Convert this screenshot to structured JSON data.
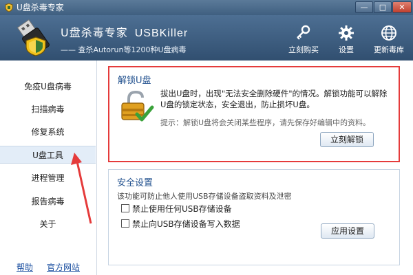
{
  "window": {
    "title": "U盘杀毒专家",
    "controls": {
      "minimize": "—",
      "maximize": "□",
      "close": "✕"
    }
  },
  "header": {
    "brand_cn": "U盘杀毒专家",
    "brand_en": "USBKiller",
    "slogan": "—— 查杀Autorun等1200种U盘病毒",
    "tools": [
      {
        "label": "立刻购买",
        "icon": "key-icon"
      },
      {
        "label": "设置",
        "icon": "gear-icon"
      },
      {
        "label": "更新毒库",
        "icon": "globe-icon"
      }
    ]
  },
  "sidebar": {
    "items": [
      {
        "label": "免疫U盘病毒"
      },
      {
        "label": "扫描病毒"
      },
      {
        "label": "修复系统"
      },
      {
        "label": "U盘工具",
        "active": true
      },
      {
        "label": "进程管理"
      },
      {
        "label": "报告病毒"
      },
      {
        "label": "关于"
      }
    ],
    "help_link": "帮助",
    "site_link": "官方网站"
  },
  "unlock_panel": {
    "title": "解锁U盘",
    "description": "拔出U盘时，出现\"无法安全删除硬件\"的情况。解锁功能可以解除U盘的锁定状态，安全退出，防止损坏U盘。",
    "hint": "提示：解锁U盘将会关闭某些程序，请先保存好编辑中的资料。",
    "button_label": "立刻解锁",
    "icon": "lock-icon"
  },
  "security_panel": {
    "title": "安全设置",
    "description": "该功能可防止他人使用USB存储设备盗取资料及泄密",
    "options": [
      {
        "label": "禁止使用任何USB存储设备",
        "checked": false
      },
      {
        "label": "禁止向USB存储设备写入数据",
        "checked": false
      }
    ],
    "button_label": "应用设置"
  },
  "colors": {
    "header_top": "#4d6f93",
    "header_bottom": "#314f70",
    "highlight_border": "#e53b3b",
    "panel_title": "#1f4f8d",
    "link": "#1b4fa0"
  }
}
